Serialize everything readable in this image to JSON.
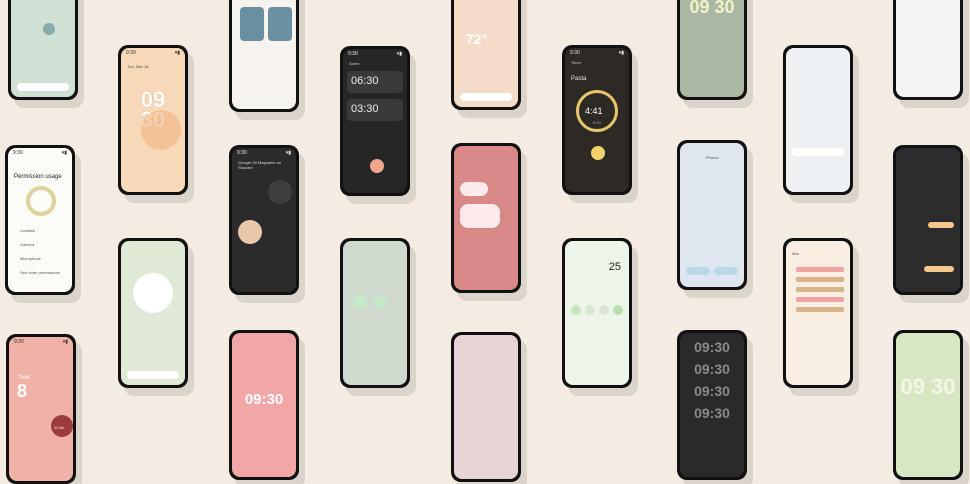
{
  "colors": {
    "background": "#f4ece3",
    "bezel": "#111111",
    "peach": "#f7d8b8",
    "sand": "#efe1cf",
    "dark_screen": "#2b2b2b",
    "pink": "#f2a7a7",
    "green_tint": "#dfe9d6",
    "lilac": "#e7dff2"
  },
  "phones": {
    "c2_clock": {
      "date": "Tue, Mar 16",
      "time": "09 30"
    },
    "c1_permission": {
      "title": "Permission usage",
      "items": [
        "Location",
        "Camera",
        "Microphone",
        "See other permissions"
      ]
    },
    "c4_alarms": {
      "title": "Alarm",
      "alarm1": "06:30",
      "alarm2": "03:30"
    },
    "c6_timer": {
      "title": "Timer",
      "label": "Pasta",
      "time": "4:41",
      "sub": "5:00"
    },
    "c5_weather": {
      "temp": "72°"
    },
    "c6_calc": {
      "result": "25"
    },
    "c8_clock": {
      "time": "09 30"
    },
    "c3_music": {
      "title": "Google Oil Magnates on Shazam"
    },
    "c1_calendar": {
      "month": "Nov",
      "day": "8",
      "temp": "12.8k"
    },
    "c3_lock": {
      "time": "09:30"
    },
    "c7_lock": {
      "lines": [
        "09:30",
        "09:30",
        "09:30",
        "09:30"
      ]
    },
    "c9_clock": {
      "time": "09 30"
    },
    "c8_cal": {
      "title": "Mar"
    },
    "c8_photo": {
      "title": "Photos"
    }
  }
}
